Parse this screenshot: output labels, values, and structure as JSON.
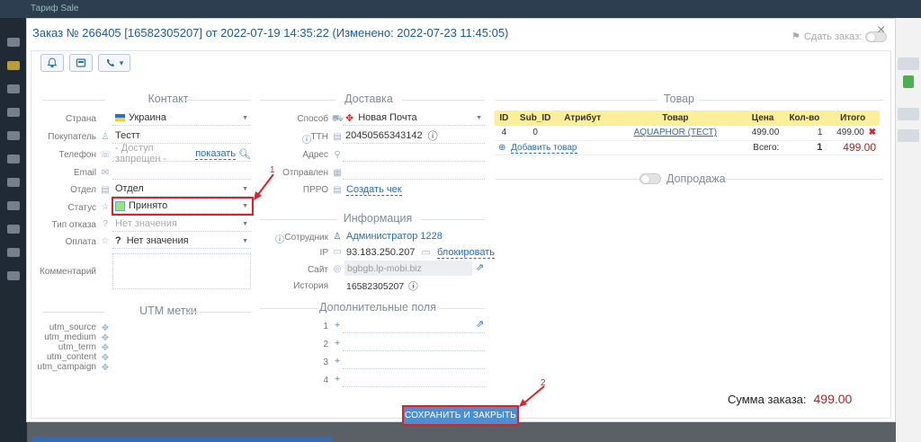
{
  "app": {
    "brand": "Тариф Sale"
  },
  "modal": {
    "title": "Заказ № 266405 [16582305207] от 2022-07-19 14:35:22 (Изменено: 2022-07-23 11:45:05)",
    "send_order_label": "Сдать заказ:",
    "close_glyph": "×"
  },
  "toolbar": {
    "bell_icon": "bell-icon",
    "card_icon": "card-icon",
    "phone_icon": "phone-icon",
    "caret": "▾"
  },
  "contact": {
    "section_title": "Контакт",
    "country_label": "Страна",
    "country_value": "Украина",
    "buyer_label": "Покупатель",
    "buyer_value": "Тестт",
    "phone_label": "Телефон",
    "phone_value": "- Доступ запрещен -",
    "phone_show": "показать",
    "email_label": "Email",
    "email_value": "",
    "dept_label": "Отдел",
    "dept_value": "Отдел",
    "status_label": "Статус",
    "status_value": "Принято",
    "status_color": "#9be37c",
    "reject_label": "Тип отказа",
    "reject_value": "Нет значения",
    "payment_label": "Оплата",
    "payment_value": "Нет значения",
    "comment_label": "Комментарий"
  },
  "utm": {
    "section_title": "UTM метки",
    "labels": [
      "utm_source",
      "utm_medium",
      "utm_term",
      "utm_content",
      "utm_campaign"
    ]
  },
  "delivery": {
    "section_title": "Доставка",
    "method_label": "Способ",
    "method_value": "Новая Почта",
    "ttn_label": "ТТН",
    "ttn_value": "20450565343142",
    "address_label": "Адрес",
    "sent_label": "Отправлен",
    "prro_label": "ПРРО",
    "prro_link": "Создать чек"
  },
  "info": {
    "section_title": "Информация",
    "employee_label": "Сотрудник",
    "employee_value": "Администратор 1228",
    "ip_label": "IP",
    "ip_value": "93.183.250.207",
    "ip_block": "блокировать",
    "site_label": "Сайт",
    "site_value": "bgbgb.lp-mobi.biz",
    "history_label": "История",
    "history_value": "16582305207"
  },
  "extra": {
    "section_title": "Дополнительные поля",
    "rows": [
      "1",
      "2",
      "3",
      "4"
    ]
  },
  "goods": {
    "section_title": "Товар",
    "columns": [
      "ID",
      "Sub_ID",
      "Атрибут",
      "Товар",
      "Цена",
      "Кол-во",
      "Итого"
    ],
    "row": {
      "id": "4",
      "sub_id": "0",
      "attr": "",
      "name": "AQUAPHOR (ТЕСТ)",
      "price": "499.00",
      "qty": "1",
      "total": "499.00"
    },
    "add_label": "Добавить товар",
    "total_label": "Всего:",
    "total_qty": "1",
    "total_sum": "499.00"
  },
  "upsell": {
    "label": "Допродажа"
  },
  "order_sum": {
    "label": "Сумма заказа:",
    "value": "499.00"
  },
  "save_button": "СОХРАНИТЬ И ЗАКРЫТЬ",
  "annotations": {
    "one": "1",
    "two": "2"
  }
}
